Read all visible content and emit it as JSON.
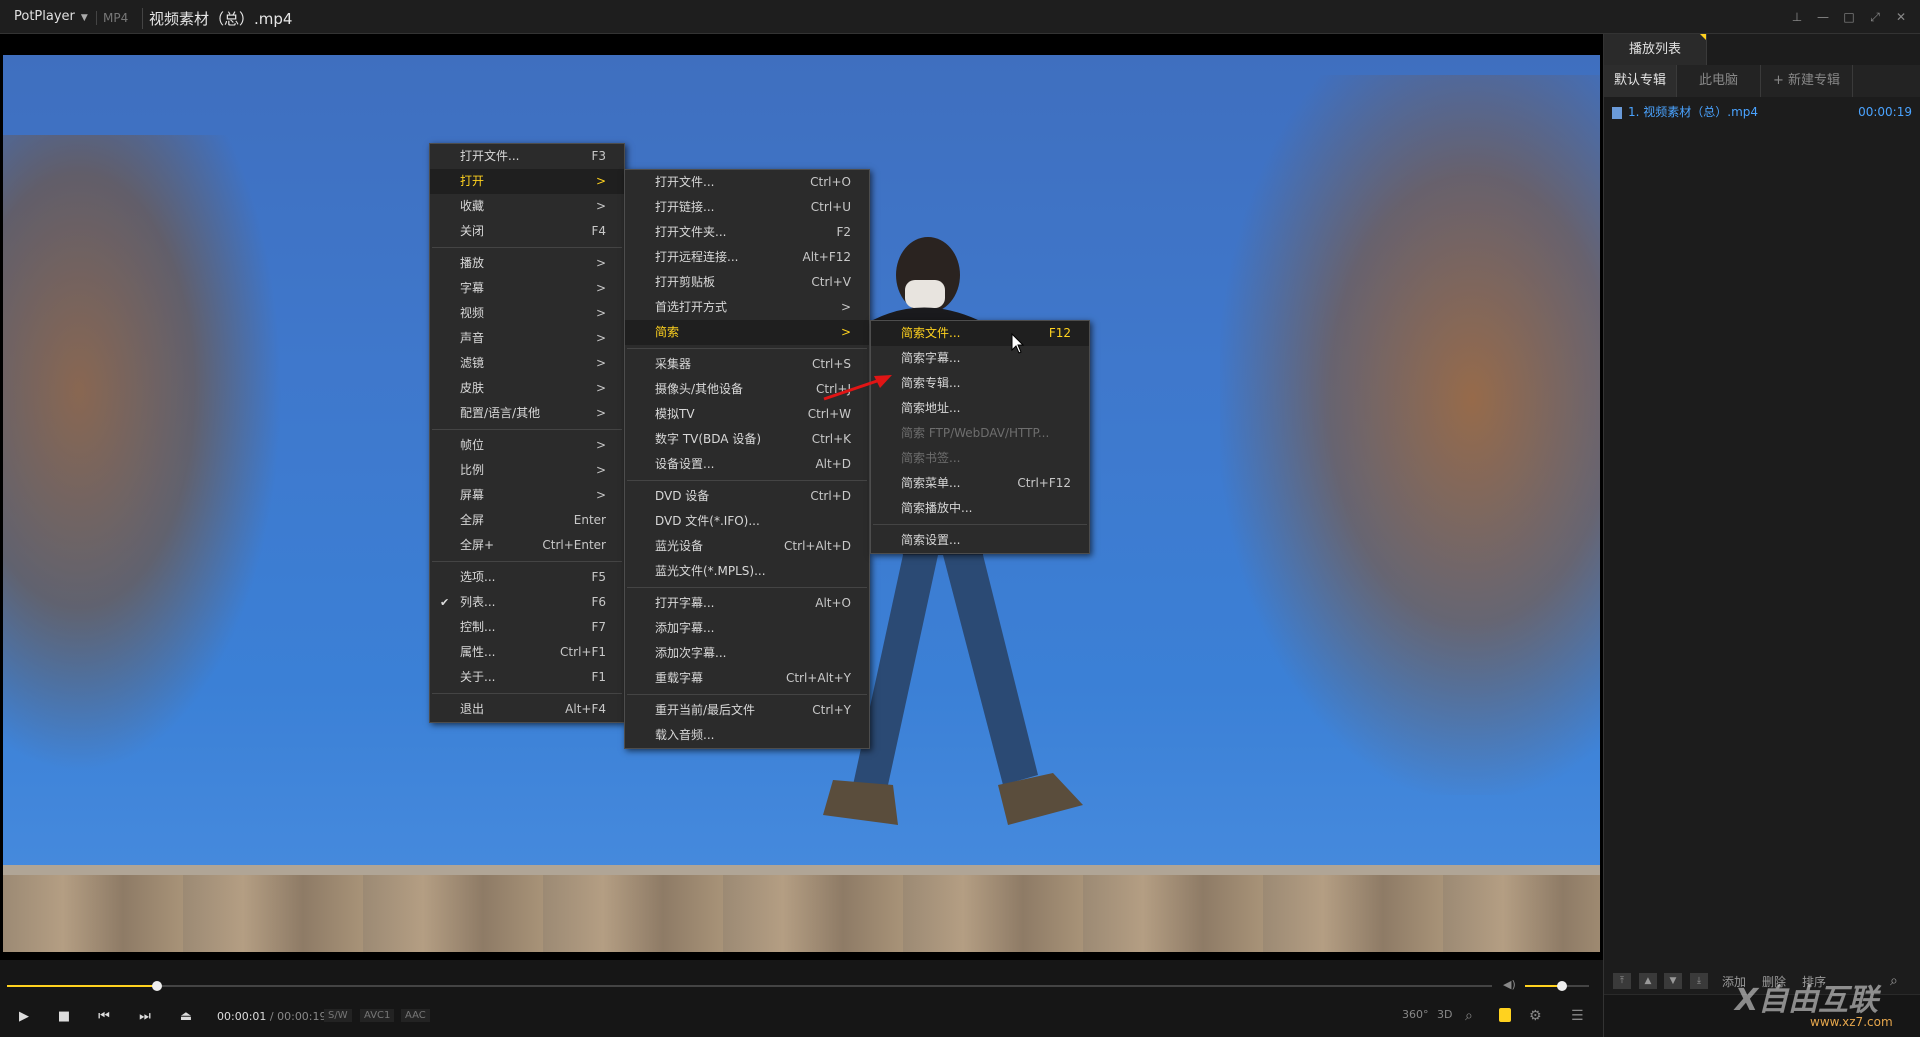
{
  "titlebar": {
    "app": "PotPlayer",
    "format": "MP4",
    "filename": "视频素材（总）.mp4"
  },
  "menu_main": [
    {
      "label": "打开文件...",
      "shortcut": "F3"
    },
    {
      "label": "打开",
      "shortcut": ">",
      "highlight": true
    },
    {
      "label": "收藏",
      "shortcut": ">"
    },
    {
      "label": "关闭",
      "shortcut": "F4"
    },
    {
      "label": "播放",
      "shortcut": ">"
    },
    {
      "label": "字幕",
      "shortcut": ">"
    },
    {
      "label": "视频",
      "shortcut": ">"
    },
    {
      "label": "声音",
      "shortcut": ">"
    },
    {
      "label": "滤镜",
      "shortcut": ">"
    },
    {
      "label": "皮肤",
      "shortcut": ">"
    },
    {
      "label": "配置/语言/其他",
      "shortcut": ">"
    },
    {
      "label": "帧位",
      "shortcut": ">"
    },
    {
      "label": "比例",
      "shortcut": ">"
    },
    {
      "label": "屏幕",
      "shortcut": ">"
    },
    {
      "label": "全屏",
      "shortcut": "Enter"
    },
    {
      "label": "全屏+",
      "shortcut": "Ctrl+Enter"
    },
    {
      "label": "选项...",
      "shortcut": "F5"
    },
    {
      "label": "列表...",
      "shortcut": "F6",
      "checked": true
    },
    {
      "label": "控制...",
      "shortcut": "F7"
    },
    {
      "label": "属性...",
      "shortcut": "Ctrl+F1"
    },
    {
      "label": "关于...",
      "shortcut": "F1"
    },
    {
      "label": "退出",
      "shortcut": "Alt+F4"
    }
  ],
  "menu_open": [
    {
      "label": "打开文件...",
      "shortcut": "Ctrl+O"
    },
    {
      "label": "打开链接...",
      "shortcut": "Ctrl+U"
    },
    {
      "label": "打开文件夹...",
      "shortcut": "F2"
    },
    {
      "label": "打开远程连接...",
      "shortcut": "Alt+F12"
    },
    {
      "label": "打开剪贴板",
      "shortcut": "Ctrl+V"
    },
    {
      "label": "首选打开方式",
      "shortcut": ">"
    },
    {
      "label": "简索",
      "shortcut": ">",
      "highlight": true
    },
    {
      "label": "采集器",
      "shortcut": "Ctrl+S"
    },
    {
      "label": "摄像头/其他设备",
      "shortcut": "Ctrl+J"
    },
    {
      "label": "模拟TV",
      "shortcut": "Ctrl+W"
    },
    {
      "label": "数字 TV(BDA 设备)",
      "shortcut": "Ctrl+K"
    },
    {
      "label": "设备设置...",
      "shortcut": "Alt+D"
    },
    {
      "label": "DVD 设备",
      "shortcut": "Ctrl+D"
    },
    {
      "label": "DVD 文件(*.IFO)...",
      "shortcut": ""
    },
    {
      "label": "蓝光设备",
      "shortcut": "Ctrl+Alt+D"
    },
    {
      "label": "蓝光文件(*.MPLS)...",
      "shortcut": ""
    },
    {
      "label": "打开字幕...",
      "shortcut": "Alt+O"
    },
    {
      "label": "添加字幕...",
      "shortcut": ""
    },
    {
      "label": "添加次字幕...",
      "shortcut": ""
    },
    {
      "label": "重载字幕",
      "shortcut": "Ctrl+Alt+Y"
    },
    {
      "label": "重开当前/最后文件",
      "shortcut": "Ctrl+Y"
    },
    {
      "label": "载入音频...",
      "shortcut": ""
    }
  ],
  "menu_jiansuo": [
    {
      "label": "简索文件...",
      "shortcut": "F12",
      "highlight": true
    },
    {
      "label": "简索字幕...",
      "shortcut": ""
    },
    {
      "label": "简索专辑...",
      "shortcut": ""
    },
    {
      "label": "简索地址...",
      "shortcut": ""
    },
    {
      "label": "简索 FTP/WebDAV/HTTP...",
      "shortcut": "",
      "disabled": true
    },
    {
      "label": "简索书签...",
      "shortcut": "",
      "disabled": true
    },
    {
      "label": "简索菜单...",
      "shortcut": "Ctrl+F12"
    },
    {
      "label": "简索播放中...",
      "shortcut": ""
    },
    {
      "label": "简索设置...",
      "shortcut": ""
    }
  ],
  "controls": {
    "time_current": "00:00:01",
    "time_sep": " / ",
    "time_total": "00:00:19",
    "tags": [
      "S/W",
      "AVC1",
      "AAC"
    ],
    "right": [
      "360°",
      "3D"
    ],
    "seek_progress": 0.05,
    "volume_level": 0.6
  },
  "playlist": {
    "tab": "播放列表",
    "subtabs": [
      "默认专辑",
      "此电脑",
      "+ 新建专辑"
    ],
    "items": [
      {
        "name": "1. 视频素材（总）.mp4",
        "duration": "00:00:19"
      }
    ],
    "buttons": [
      "添加",
      "删除",
      "排序"
    ]
  },
  "watermark": {
    "text": "X自由互联",
    "url": "www.xz7.com"
  }
}
